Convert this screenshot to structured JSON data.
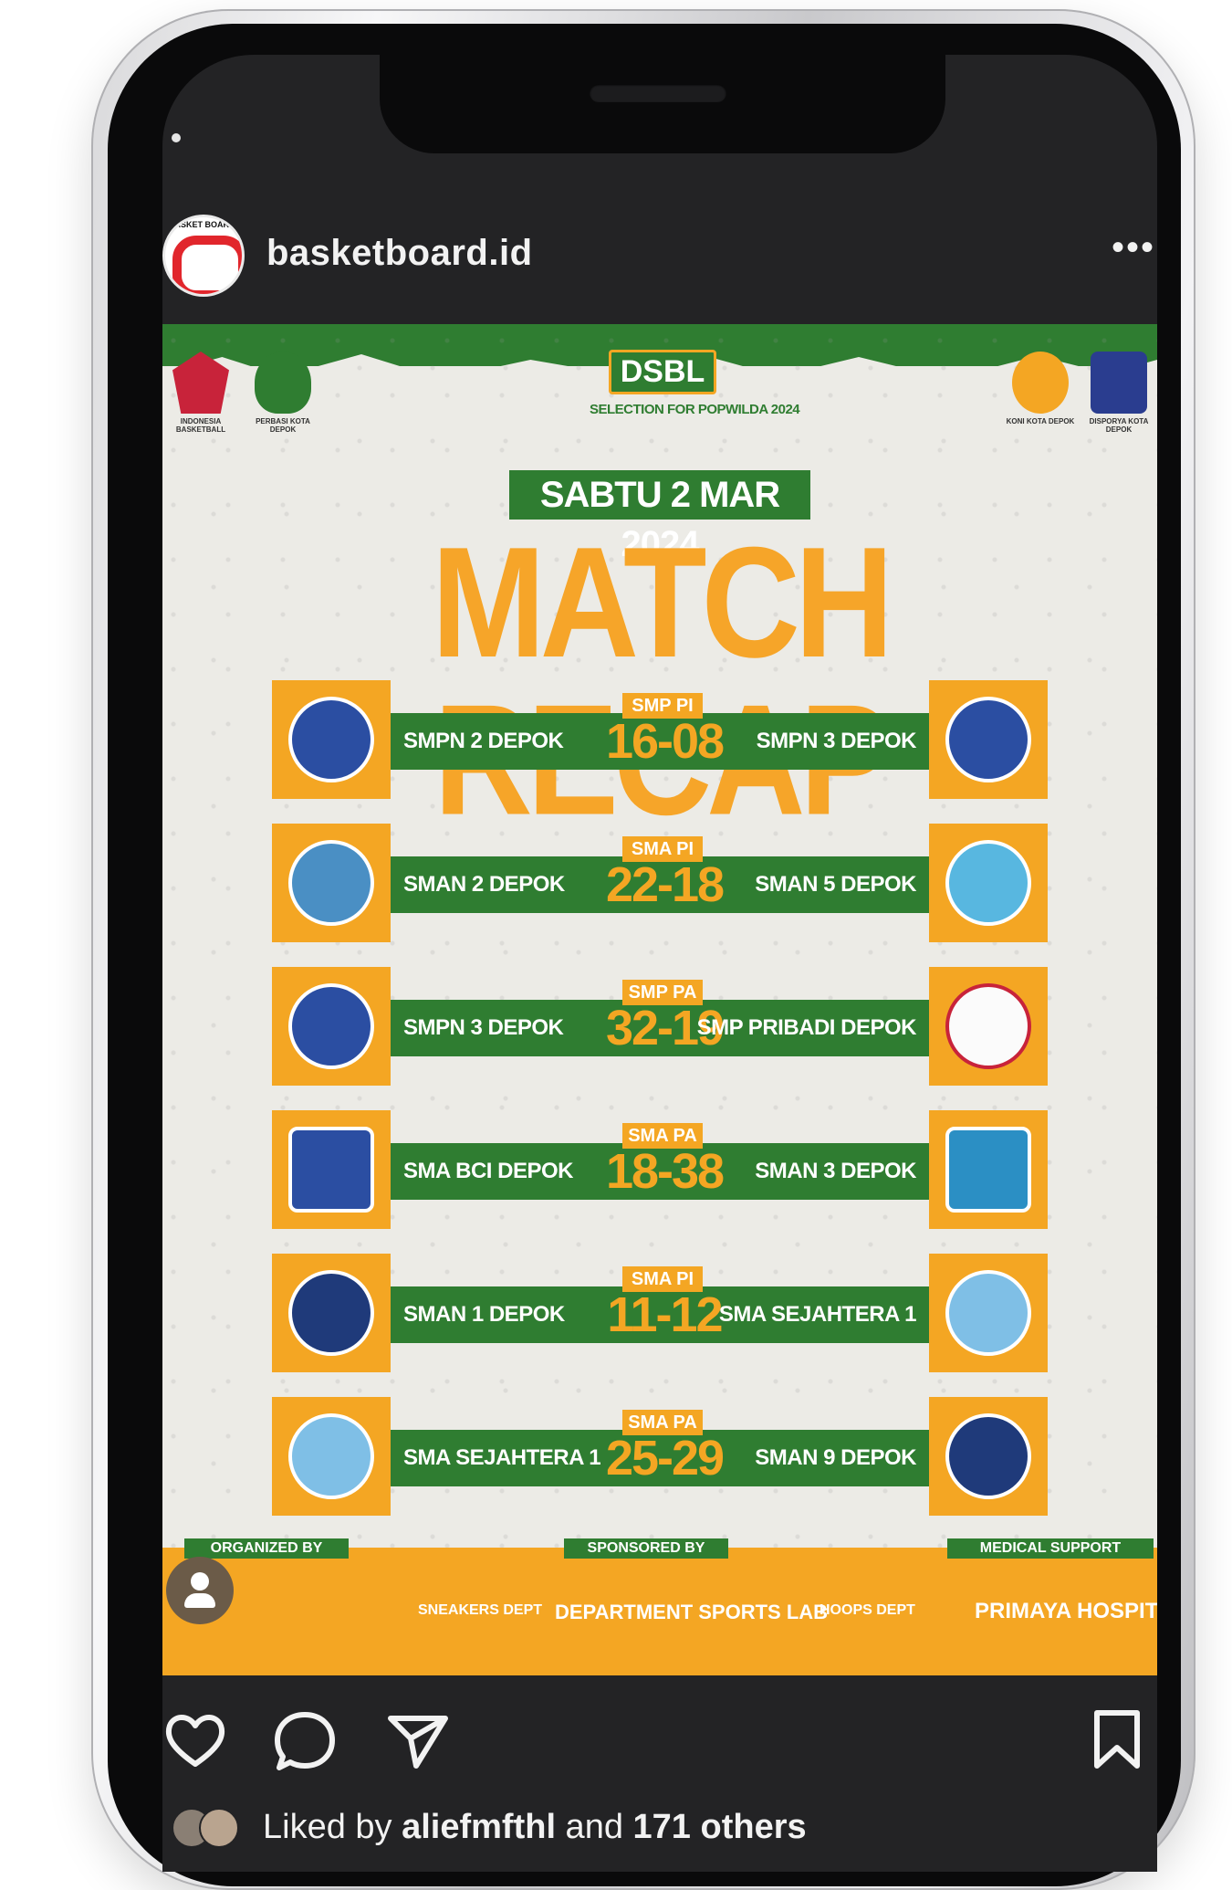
{
  "account": {
    "username": "basketboard.id",
    "avatar_text": "BASKET BOARD",
    "more_label": "•••"
  },
  "post": {
    "top_logos": [
      {
        "label": "INDONESIA BASKETBALL",
        "color": "#c8233a"
      },
      {
        "label": "PERBASI KOTA DEPOK",
        "color": "#2f7d31"
      },
      {
        "label": "KONI KOTA DEPOK",
        "color": "#f4a623"
      },
      {
        "label": "DISPORYA KOTA DEPOK",
        "color": "#2a3d8f"
      }
    ],
    "event_logo": "DSBL",
    "event_subtitle": "SELECTION FOR POPWILDA 2024",
    "date": "SABTU 2 MAR 2024",
    "title": "MATCH RECAP",
    "matches": [
      {
        "category": "SMP PI",
        "home": "SMPN 2 DEPOK",
        "score": "16-08",
        "away": "SMPN 3 DEPOK"
      },
      {
        "category": "SMA PI",
        "home": "SMAN 2 DEPOK",
        "score": "22-18",
        "away": "SMAN 5 DEPOK"
      },
      {
        "category": "SMP PA",
        "home": "SMPN 3 DEPOK",
        "score": "32-19",
        "away": "SMP PRIBADI DEPOK"
      },
      {
        "category": "SMA PA",
        "home": "SMA BCI DEPOK",
        "score": "18-38",
        "away": "SMAN 3 DEPOK"
      },
      {
        "category": "SMA PI",
        "home": "SMAN 1 DEPOK",
        "score": "11-12",
        "away": "SMA SEJAHTERA 1"
      },
      {
        "category": "SMA PA",
        "home": "SMA SEJAHTERA 1",
        "score": "25-29",
        "away": "SMAN 9 DEPOK"
      }
    ],
    "footer_labels": {
      "organized": "ORGANIZED BY",
      "sponsored": "SPONSORED BY",
      "medical": "MEDICAL SUPPORT"
    },
    "sponsors": [
      "SNEAKERS DEPT",
      "DEPARTMENT SPORTS LAB",
      "HOOPS DEPT",
      "PRIMAYA HOSPITAL"
    ]
  },
  "likes": {
    "prefix": "Liked by ",
    "user": "aliefmfthl",
    "middle": " and ",
    "others": "171 others"
  },
  "colors": {
    "green": "#2f7d31",
    "orange": "#f4a623",
    "title_orange": "#f6a529",
    "background": "#ecebe6"
  }
}
